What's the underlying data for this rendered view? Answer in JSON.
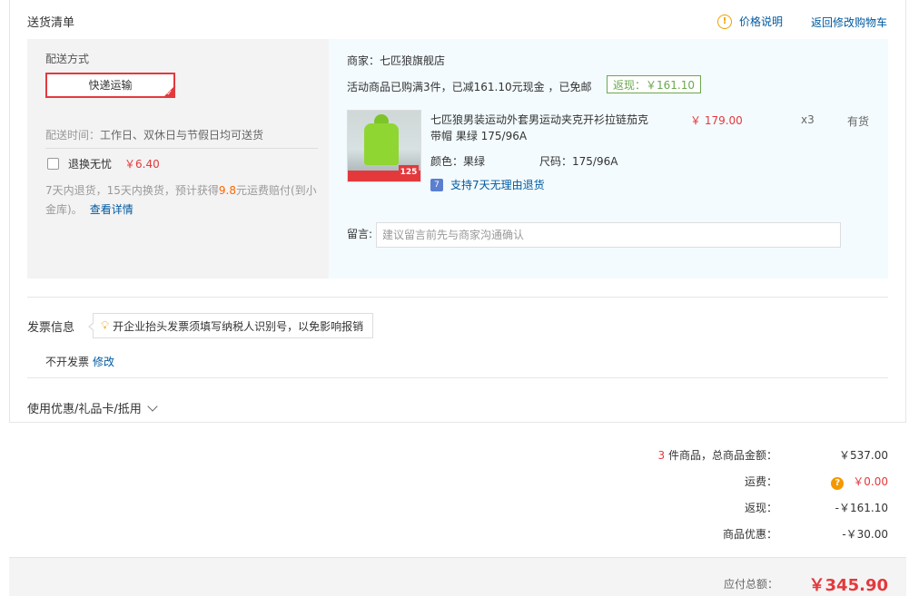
{
  "header": {
    "title": "送货清单",
    "price_note": "价格说明",
    "back_to_cart": "返回修改购物车"
  },
  "shipping": {
    "label": "配送方式",
    "method": "快递运输",
    "time_label": "配送时间：",
    "time_value": "工作日、双休日与节假日均可送货",
    "worry_free_label": "退换无忧",
    "worry_free_price": "￥6.40",
    "worry_desc_a": "7天内退货，15天内换货，预计获得",
    "worry_desc_amount": "9.8",
    "worry_desc_b": "元运费赔付(到小金库)。",
    "details_link": "查看详情"
  },
  "goods": {
    "merchant": "商家：七匹狼旗舰店",
    "promo": "活动商品已购满3件，已减161.10元现金 ，已免邮",
    "cashback": "返现：￥161.10",
    "product": {
      "name": "七匹狼男装运动外套男运动夹克开衫拉链茄克带帽 果绿 175/96A",
      "price": "￥ 179.00",
      "qty": "x3",
      "stock": "有货",
      "color": "颜色：果绿",
      "size": "尺码：175/96A",
      "return_policy": "支持7天无理由退货",
      "thumb_badge": "125"
    },
    "message_label": "留言:",
    "message_placeholder": "建议留言前先与商家沟通确认"
  },
  "invoice": {
    "title": "发票信息",
    "tip": "开企业抬头发票须填写纳税人识别号，以免影响报销",
    "value": "不开发票",
    "edit": "修改"
  },
  "coupon": {
    "label": "使用优惠/礼品卡/抵用"
  },
  "summary": {
    "count": "3",
    "count_label": " 件商品，总商品金额：",
    "goods_total": "￥537.00",
    "freight_label": "运费：",
    "freight": "￥0.00",
    "cashback_label": "返现：",
    "cashback": "-￥161.10",
    "discount_label": "商品优惠：",
    "discount": "-￥30.00",
    "payable_label": "应付总额：",
    "payable": "￥345.90"
  },
  "colors": {
    "accent_red": "#e4393c",
    "link_blue": "#005aa0",
    "cashback_green": "#6aa84f"
  }
}
